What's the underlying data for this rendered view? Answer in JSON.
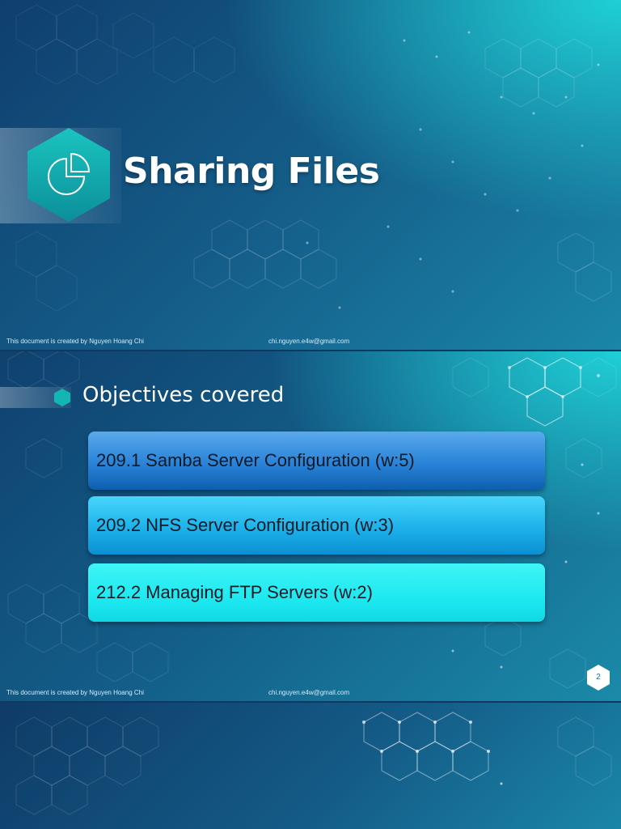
{
  "slide1": {
    "title": "Sharing Files",
    "logo_icon": "pie-chart-icon",
    "footer_left": "This document is created by Nguyen Hoang Chi",
    "footer_right": "chi.nguyen.e4w@gmail.com"
  },
  "slide2": {
    "heading": "Objectives covered",
    "objectives": [
      "209.1 Samba Server Configuration (w:5)",
      "209.2 NFS Server Configuration (w:3)",
      "212.2 Managing FTP Servers (w:2)"
    ],
    "page_number": "2",
    "footer_left": "This document is created by Nguyen Hoang Chi",
    "footer_right": "chi.nguyen.e4w@gmail.com"
  },
  "colors": {
    "hex_accent": "#12b6b3",
    "objective_1": "#2a83d8",
    "objective_2": "#1aaee8",
    "objective_3": "#1ee9f0"
  }
}
